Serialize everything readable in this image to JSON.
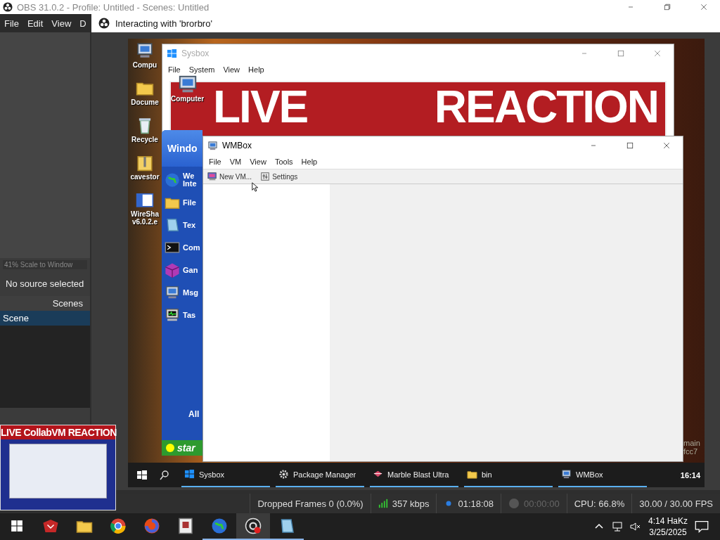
{
  "obs": {
    "title": "OBS 31.0.2 - Profile: Untitled - Scenes: Untitled",
    "menu": [
      "File",
      "Edit",
      "View",
      "D"
    ],
    "scale_label": "41% Scale to Window",
    "source_status": "No source selected",
    "scenes_header": "Scenes",
    "scenes": [
      {
        "name": "Scene",
        "selected": true
      }
    ],
    "thumbnail": {
      "banner": "LIVE CollabVM REACTION"
    },
    "status_bar": {
      "dropped": "Dropped Frames 0 (0.0%)",
      "bitrate": "357 kbps",
      "stream_time": "01:18:08",
      "record_time": "00:00:00",
      "cpu": "CPU: 66.8%",
      "fps": "30.00 / 30.00 FPS"
    }
  },
  "dialog": {
    "title": "Interacting with 'brorbro'"
  },
  "vm": {
    "desktop_icons": [
      {
        "label": "Compu",
        "kind": "computer"
      },
      {
        "label": "Docume",
        "kind": "folder"
      },
      {
        "label": "Recycle",
        "kind": "bin"
      },
      {
        "label": "cavestor",
        "kind": "zip"
      },
      {
        "label": "WireSha",
        "sub": "v6.0.2.e",
        "kind": "installer"
      }
    ],
    "sysbox": {
      "title": "Sysbox",
      "menu": [
        "File",
        "System",
        "View",
        "Help"
      ],
      "icon_label": "Computer",
      "banner_left": "LIVE",
      "banner_right": "REACTION"
    },
    "start_menu": {
      "header": "Windo",
      "items": [
        {
          "label": "We",
          "sub": "Inte",
          "kind": "globe"
        },
        {
          "label": "File",
          "kind": "folder"
        },
        {
          "label": "Tex",
          "kind": "notepad"
        },
        {
          "label": "Com",
          "kind": "terminal"
        },
        {
          "label": "Gan",
          "kind": "cube"
        },
        {
          "label": "Msg",
          "kind": "computer"
        },
        {
          "label": "Tas",
          "kind": "monitor"
        }
      ],
      "all": "All",
      "start": "star"
    },
    "wmbox": {
      "title": "WMBox",
      "menu": [
        "File",
        "VM",
        "View",
        "Tools",
        "Help"
      ],
      "toolbar": [
        {
          "label": "New VM...",
          "kind": "new"
        },
        {
          "label": "Settings",
          "kind": "settings"
        }
      ]
    },
    "taskbar": {
      "items": [
        {
          "label": "Sysbox",
          "kind": "windows"
        },
        {
          "label": "Package Manager",
          "kind": "gear"
        },
        {
          "label": "Marble Blast Ultra",
          "kind": "diamond"
        },
        {
          "label": "bin",
          "kind": "folder"
        },
        {
          "label": "WMBox",
          "kind": "computer"
        }
      ],
      "clock": "16:14"
    },
    "edge_text": [
      "main",
      "fcc7"
    ]
  },
  "taskbar": {
    "apps": [
      {
        "kind": "game",
        "running": false,
        "selected": false
      },
      {
        "kind": "folder",
        "running": false,
        "selected": false
      },
      {
        "kind": "browser",
        "running": false,
        "selected": false
      },
      {
        "kind": "spiral",
        "running": false,
        "selected": false
      },
      {
        "kind": "archive",
        "running": false,
        "selected": false
      },
      {
        "kind": "globe",
        "running": true,
        "selected": false
      },
      {
        "kind": "recorder",
        "running": true,
        "selected": true
      },
      {
        "kind": "notepad",
        "running": true,
        "selected": false
      }
    ],
    "time": "4:14 HaKz",
    "date": "3/25/2025"
  }
}
